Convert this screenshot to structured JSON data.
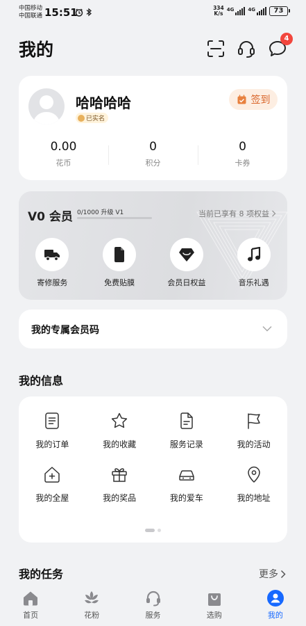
{
  "status_bar": {
    "carrier_1": "中国移动",
    "carrier_2": "中国联通",
    "time": "15:51",
    "net_speed_value": "334",
    "net_speed_unit": "K/s",
    "network_1": "4G",
    "network_2": "4G",
    "battery": "73"
  },
  "header": {
    "title": "我的",
    "notification_count": "4",
    "icons": [
      "scan-icon",
      "headset-icon",
      "message-icon"
    ]
  },
  "profile": {
    "username": "哈哈哈哈",
    "verified_label": "已实名",
    "checkin_label": "签到",
    "stats": [
      {
        "value": "0.00",
        "label": "花币"
      },
      {
        "value": "0",
        "label": "积分"
      },
      {
        "value": "0",
        "label": "卡券"
      }
    ]
  },
  "membership": {
    "level": "V0 会员",
    "progress_text": "0/1000 升级 V1",
    "progress_fraction": 0.0,
    "rights_text": "当前已享有 8 项权益",
    "perks": [
      {
        "label": "寄修服务",
        "icon": "truck-icon"
      },
      {
        "label": "免费贴膜",
        "icon": "phone-film-icon"
      },
      {
        "label": "会员日权益",
        "icon": "diamond-icon"
      },
      {
        "label": "音乐礼遇",
        "icon": "music-note-icon"
      }
    ]
  },
  "member_code": {
    "label": "我的专属会员码"
  },
  "my_info": {
    "title": "我的信息",
    "items": [
      {
        "label": "我的订单",
        "icon": "order-icon"
      },
      {
        "label": "我的收藏",
        "icon": "star-icon"
      },
      {
        "label": "服务记录",
        "icon": "service-record-icon"
      },
      {
        "label": "我的活动",
        "icon": "flag-icon"
      },
      {
        "label": "我的全屋",
        "icon": "house-icon"
      },
      {
        "label": "我的奖品",
        "icon": "gift-icon"
      },
      {
        "label": "我的爱车",
        "icon": "car-icon"
      },
      {
        "label": "我的地址",
        "icon": "location-icon"
      }
    ]
  },
  "my_tasks": {
    "title": "我的任务",
    "more_label": "更多"
  },
  "bottom_nav": {
    "items": [
      {
        "label": "首页",
        "icon": "home-icon"
      },
      {
        "label": "花粉",
        "icon": "flower-icon"
      },
      {
        "label": "服务",
        "icon": "service-icon"
      },
      {
        "label": "选购",
        "icon": "shopping-bag-icon"
      },
      {
        "label": "我的",
        "icon": "profile-icon"
      }
    ],
    "active_index": 4,
    "active_color": "#1769ff"
  },
  "colors": {
    "background": "#f1f2f4",
    "card": "#ffffff",
    "checkin_bg": "#fdeee2",
    "checkin_fg": "#d9652a",
    "badge": "#f2463d"
  }
}
